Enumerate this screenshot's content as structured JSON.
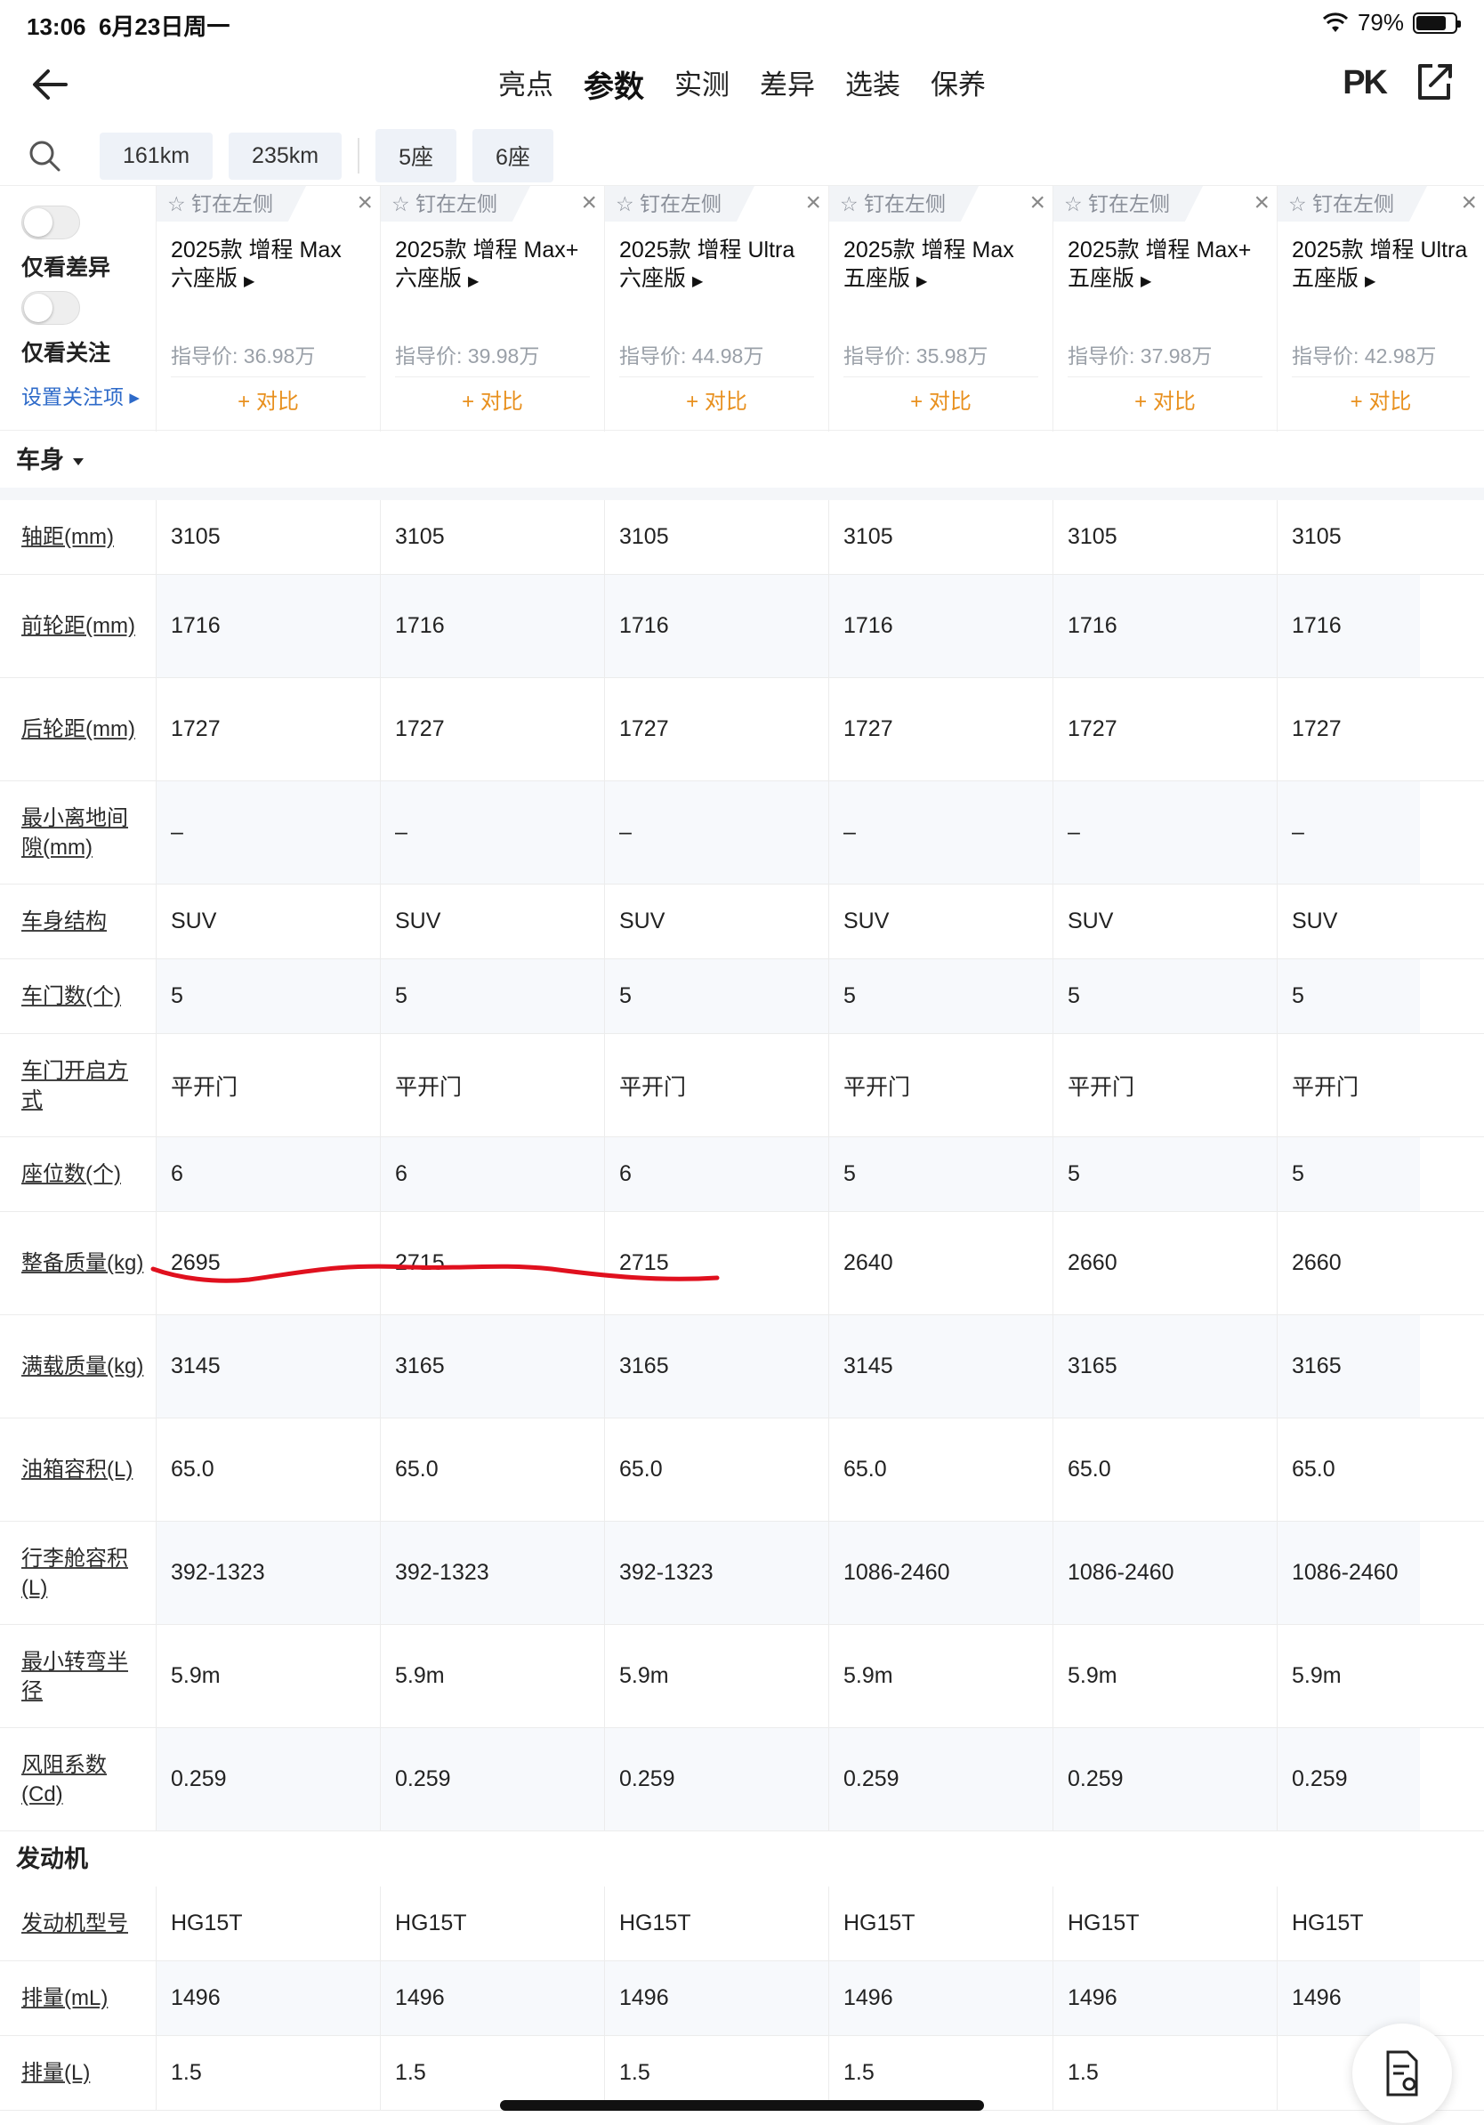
{
  "status": {
    "time": "13:06",
    "date": "6月23日周一",
    "battery": "79%",
    "battery_level": 0.79
  },
  "nav": {
    "tabs": [
      "亮点",
      "参数",
      "实测",
      "差异",
      "选装",
      "保养"
    ],
    "active_tab": "参数",
    "pk": "PK"
  },
  "filters": [
    "161km",
    "235km",
    "5座",
    "6座"
  ],
  "controls": {
    "only_diff": "仅看差异",
    "only_follow": "仅看关注",
    "settings": "设置关注项"
  },
  "pin_label": "钉在左侧",
  "compare_label": "+ 对比",
  "cars": [
    {
      "name1": "2025款 增程 Max",
      "name2": "六座版",
      "price": "指导价:  36.98万"
    },
    {
      "name1": "2025款 增程 Max+",
      "name2": "六座版",
      "price": "指导价:  39.98万"
    },
    {
      "name1": "2025款 增程 Ultra",
      "name2": "六座版",
      "price": "指导价:  44.98万"
    },
    {
      "name1": "2025款 增程 Max",
      "name2": "五座版",
      "price": "指导价:  35.98万"
    },
    {
      "name1": "2025款 增程 Max+",
      "name2": "五座版",
      "price": "指导价:  37.98万"
    },
    {
      "name1": "2025款 增程 Ultra",
      "name2": "五座版",
      "price": "指导价:  42.98万"
    }
  ],
  "sections": [
    {
      "title": "车身",
      "rows": [
        {
          "label": "轴距(mm)",
          "values": [
            "3105",
            "3105",
            "3105",
            "3105",
            "3105",
            "3105"
          ]
        },
        {
          "label": "前轮距(mm)",
          "values": [
            "1716",
            "1716",
            "1716",
            "1716",
            "1716",
            "1716"
          ]
        },
        {
          "label": "后轮距(mm)",
          "values": [
            "1727",
            "1727",
            "1727",
            "1727",
            "1727",
            "1727"
          ]
        },
        {
          "label": "最小离地间隙(mm)",
          "values": [
            "–",
            "–",
            "–",
            "–",
            "–",
            "–"
          ]
        },
        {
          "label": "车身结构",
          "values": [
            "SUV",
            "SUV",
            "SUV",
            "SUV",
            "SUV",
            "SUV"
          ]
        },
        {
          "label": "车门数(个)",
          "values": [
            "5",
            "5",
            "5",
            "5",
            "5",
            "5"
          ]
        },
        {
          "label": "车门开启方式",
          "values": [
            "平开门",
            "平开门",
            "平开门",
            "平开门",
            "平开门",
            "平开门"
          ]
        },
        {
          "label": "座位数(个)",
          "values": [
            "6",
            "6",
            "6",
            "5",
            "5",
            "5"
          ]
        },
        {
          "label": "整备质量(kg)",
          "values": [
            "2695",
            "2715",
            "2715",
            "2640",
            "2660",
            "2660"
          ]
        },
        {
          "label": "满载质量(kg)",
          "values": [
            "3145",
            "3165",
            "3165",
            "3145",
            "3165",
            "3165"
          ]
        },
        {
          "label": "油箱容积(L)",
          "values": [
            "65.0",
            "65.0",
            "65.0",
            "65.0",
            "65.0",
            "65.0"
          ]
        },
        {
          "label": "行李舱容积(L)",
          "values": [
            "392-1323",
            "392-1323",
            "392-1323",
            "1086-2460",
            "1086-2460",
            "1086-2460"
          ]
        },
        {
          "label": "最小转弯半径",
          "values": [
            "5.9m",
            "5.9m",
            "5.9m",
            "5.9m",
            "5.9m",
            "5.9m"
          ]
        },
        {
          "label": "风阻系数(Cd)",
          "values": [
            "0.259",
            "0.259",
            "0.259",
            "0.259",
            "0.259",
            "0.259"
          ]
        }
      ]
    },
    {
      "title": "发动机",
      "rows": [
        {
          "label": "发动机型号",
          "values": [
            "HG15T",
            "HG15T",
            "HG15T",
            "HG15T",
            "HG15T",
            "HG15T"
          ]
        },
        {
          "label": "排量(mL)",
          "values": [
            "1496",
            "1496",
            "1496",
            "1496",
            "1496",
            "1496"
          ]
        },
        {
          "label": "排量(L)",
          "values": [
            "1.5",
            "1.5",
            "1.5",
            "1.5",
            "1.5",
            ""
          ]
        }
      ]
    }
  ],
  "colors": {
    "accent": "#e8901e",
    "link": "#2d6ac9",
    "tab_highlight": "#ffd93a",
    "annotation": "#e0101e"
  }
}
